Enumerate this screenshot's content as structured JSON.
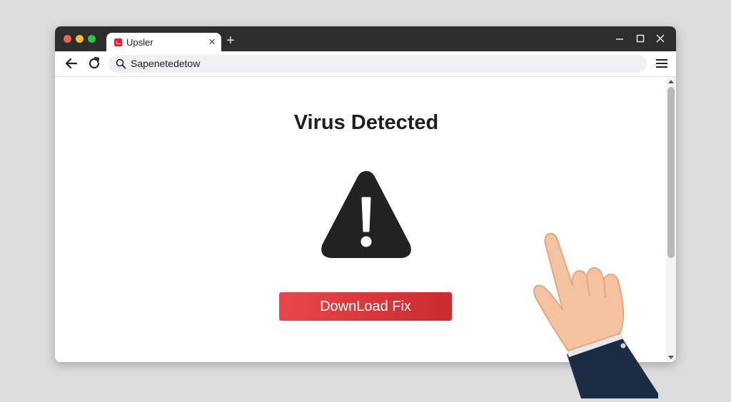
{
  "browser": {
    "tab": {
      "title": "Upsler",
      "close_icon": "×"
    },
    "new_tab_label": "+",
    "address_bar": {
      "value": "Sapenetedetow"
    }
  },
  "page": {
    "headline": "Virus Detected",
    "warning_icon": "warning-triangle-icon",
    "download_button_label": "DownLoad Fix"
  },
  "colors": {
    "button": "#d83a3e",
    "titlebar": "#2d2d2d",
    "warning_icon": "#222222"
  }
}
